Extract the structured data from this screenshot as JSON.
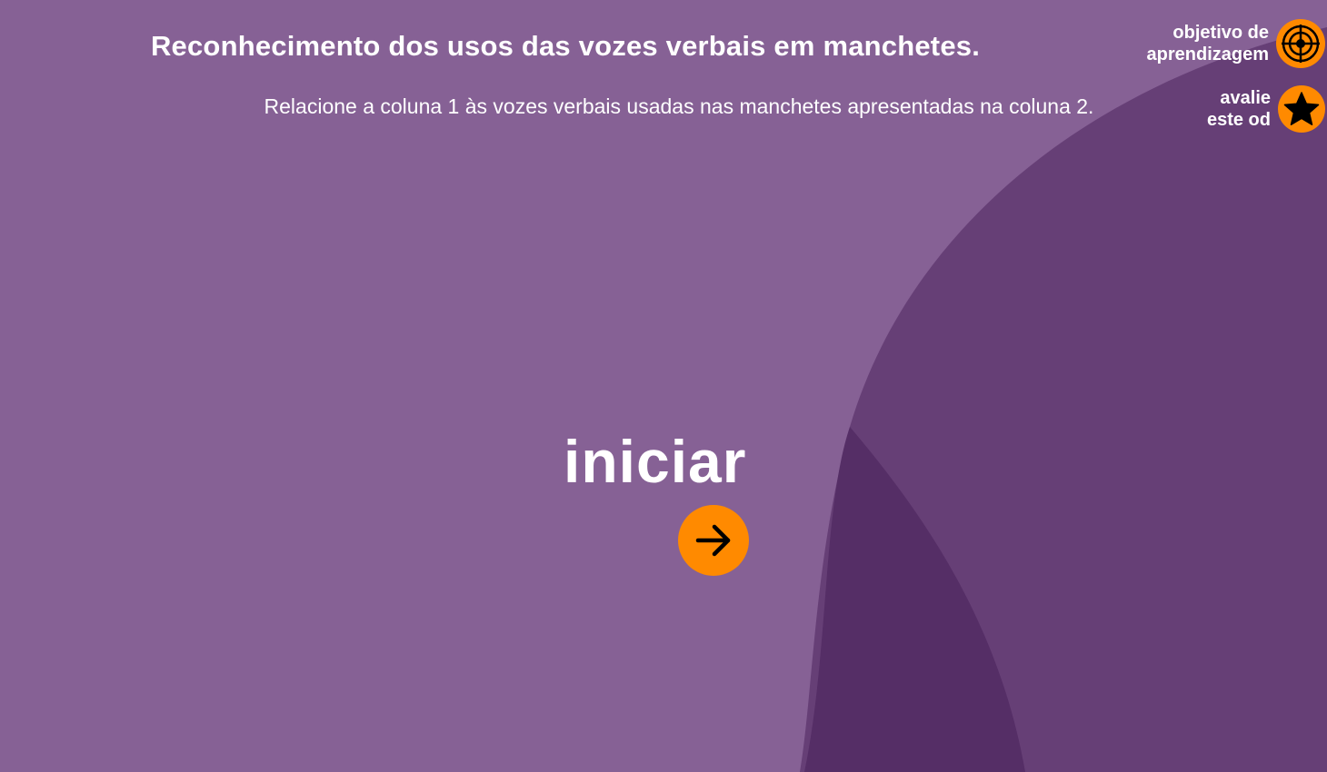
{
  "header": {
    "title": "Reconhecimento dos usos das vozes verbais em manchetes.",
    "instructions": "Relacione a coluna 1 às vozes verbais usadas nas manchetes apresentadas na coluna 2."
  },
  "side_links": {
    "objective": {
      "line1": "objetivo de",
      "line2": "aprendizagem",
      "icon": "target-icon"
    },
    "rate": {
      "line1": "avalie",
      "line2": "este od",
      "icon": "star-icon"
    }
  },
  "start": {
    "label": "iniciar",
    "icon": "arrow-right-icon"
  },
  "colors": {
    "background": "#866195",
    "shape_mid": "#663f76",
    "shape_dark": "#552e66",
    "accent": "#ff8a00",
    "text": "#ffffff"
  }
}
